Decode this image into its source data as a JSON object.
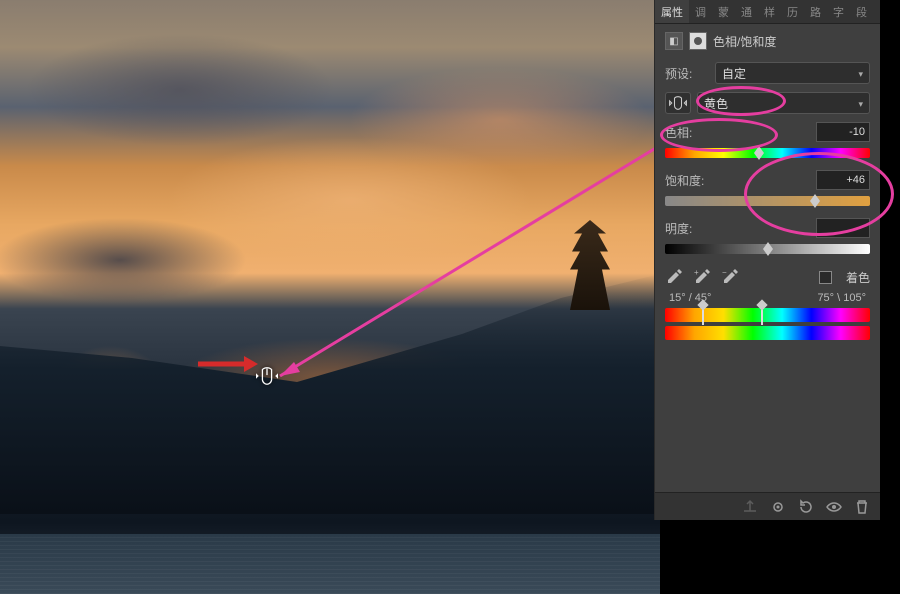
{
  "tabs": {
    "items": [
      "属性",
      "调",
      "蒙",
      "通",
      "样",
      "历",
      "路",
      "字",
      "段"
    ],
    "active_index": 0
  },
  "section": {
    "title": "色相/饱和度"
  },
  "preset": {
    "label": "预设:",
    "value": "自定"
  },
  "color": {
    "value": "黄色"
  },
  "hue": {
    "label": "色相:",
    "value": "-10",
    "pos_pct": 46
  },
  "saturation": {
    "label": "饱和度:",
    "value": "+46",
    "pos_pct": 73
  },
  "lightness": {
    "label": "明度:",
    "value": "",
    "pos_pct": 50
  },
  "colorize": {
    "label": "着色",
    "checked": false
  },
  "range": {
    "left": "15° / 45°",
    "right": "75° \\ 105°"
  },
  "icons": {
    "scrubby": "scrubby-icon",
    "eyedrop": "eyedropper-icon",
    "eyedrop_plus": "eyedropper-plus-icon",
    "eyedrop_minus": "eyedropper-minus-icon"
  }
}
